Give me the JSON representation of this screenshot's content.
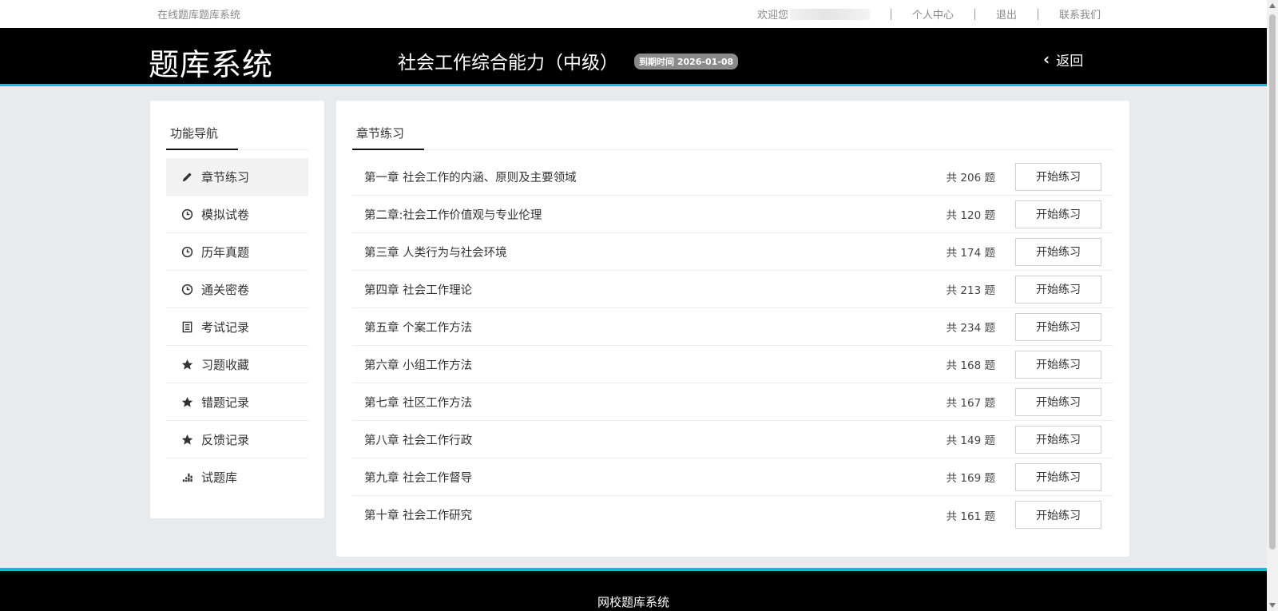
{
  "topbar": {
    "site_name": "在线题库题库系统",
    "welcome": "欢迎您",
    "links": [
      "个人中心",
      "退出",
      "联系我们"
    ]
  },
  "header": {
    "brand": "题库系统",
    "course_title": "社会工作综合能力（中级）",
    "expire_badge": "到期时间 2026-01-08",
    "back_label": "返回"
  },
  "sidebar": {
    "title": "功能导航",
    "items": [
      {
        "label": "章节练习",
        "icon": "pencil-icon",
        "active": true
      },
      {
        "label": "模拟试卷",
        "icon": "clock-icon"
      },
      {
        "label": "历年真题",
        "icon": "clock-icon"
      },
      {
        "label": "通关密卷",
        "icon": "clock-icon"
      },
      {
        "label": "考试记录",
        "icon": "list-icon"
      },
      {
        "label": "习题收藏",
        "icon": "star-icon"
      },
      {
        "label": "错题记录",
        "icon": "star-icon"
      },
      {
        "label": "反馈记录",
        "icon": "star-icon"
      },
      {
        "label": "试题库",
        "icon": "bar-chart-icon"
      }
    ]
  },
  "main": {
    "title": "章节练习",
    "start_label": "开始练习",
    "chapters": [
      {
        "name": "第一章 社会工作的内涵、原则及主要领域",
        "count": "共 206 题"
      },
      {
        "name": "第二章:社会工作价值观与专业伦理",
        "count": "共 120 题"
      },
      {
        "name": "第三章 人类行为与社会环境",
        "count": "共 174 题"
      },
      {
        "name": "第四章 社会工作理论",
        "count": "共 213 题"
      },
      {
        "name": "第五章 个案工作方法",
        "count": "共 234 题"
      },
      {
        "name": "第六章 小组工作方法",
        "count": "共 168 题"
      },
      {
        "name": "第七章 社区工作方法",
        "count": "共 167 题"
      },
      {
        "name": "第八章 社会工作行政",
        "count": "共 149 题"
      },
      {
        "name": "第九章 社会工作督导",
        "count": "共 169 题"
      },
      {
        "name": "第十章 社会工作研究",
        "count": "共 161 题"
      }
    ]
  },
  "footer": {
    "text": "网校题库系统"
  },
  "colors": {
    "accent": "#16b9d4",
    "header_bg": "#000000",
    "page_bg": "#e8ebee"
  }
}
